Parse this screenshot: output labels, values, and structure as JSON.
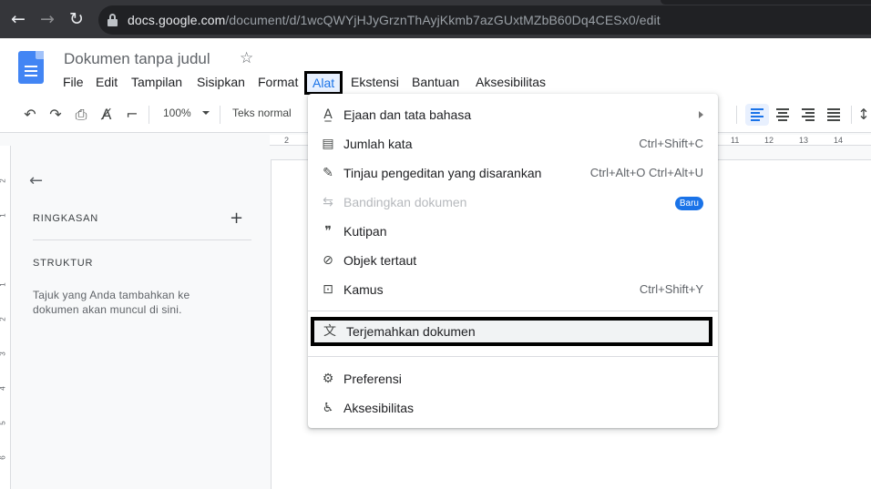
{
  "browser": {
    "url_host": "docs.google.com",
    "url_path": "/document/d/1wcQWYjHJyGrznThAyjKkmb7azGUxtMZbB60Dq4CESx0/edit"
  },
  "doc": {
    "title": "Dokumen tanpa judul"
  },
  "menubar": {
    "items": [
      "File",
      "Edit",
      "Tampilan",
      "Sisipkan",
      "Format",
      "Alat",
      "Ekstensi",
      "Bantuan",
      "Aksesibilitas"
    ],
    "active": "Alat"
  },
  "toolbar": {
    "zoom": "100%",
    "style": "Teks normal"
  },
  "ruler": {
    "numbers": [
      "2",
      "11",
      "12",
      "13",
      "14"
    ]
  },
  "vruler": {
    "numbers": [
      "2",
      "1",
      "1",
      "2",
      "3",
      "4",
      "5",
      "6"
    ]
  },
  "outline": {
    "summary_label": "RINGKASAN",
    "structure_label": "STRUKTUR",
    "hint": "Tajuk yang Anda tambahkan ke dokumen akan muncul di sini."
  },
  "tools_menu": {
    "items": [
      {
        "label": "Ejaan dan tata bahasa",
        "icon": "spellcheck-icon",
        "glyph": "A̲",
        "submenu": true
      },
      {
        "label": "Jumlah kata",
        "icon": "word-count-icon",
        "glyph": "▤",
        "shortcut": "Ctrl+Shift+C"
      },
      {
        "label": "Tinjau pengeditan yang disarankan",
        "icon": "review-edits-icon",
        "glyph": "✎",
        "shortcut": "Ctrl+Alt+O Ctrl+Alt+U"
      },
      {
        "label": "Bandingkan dokumen",
        "icon": "compare-icon",
        "glyph": "⇆",
        "badge": "Baru",
        "disabled": true
      },
      {
        "label": "Kutipan",
        "icon": "citation-icon",
        "glyph": "❞"
      },
      {
        "label": "Objek tertaut",
        "icon": "linked-objects-icon",
        "glyph": "⊘"
      },
      {
        "label": "Kamus",
        "icon": "dictionary-icon",
        "glyph": "⊡",
        "shortcut": "Ctrl+Shift+Y"
      },
      {
        "label": "Terjemahkan dokumen",
        "icon": "translate-icon",
        "glyph": "文",
        "highlighted": true
      },
      {
        "label": "Preferensi",
        "icon": "preferences-icon",
        "glyph": "⚙"
      },
      {
        "label": "Aksesibilitas",
        "icon": "accessibility-icon",
        "glyph": "♿"
      }
    ]
  },
  "colors": {
    "accent": "#1a73e8",
    "docs_blue": "#4285f4",
    "chrome_dark": "#35363a"
  }
}
